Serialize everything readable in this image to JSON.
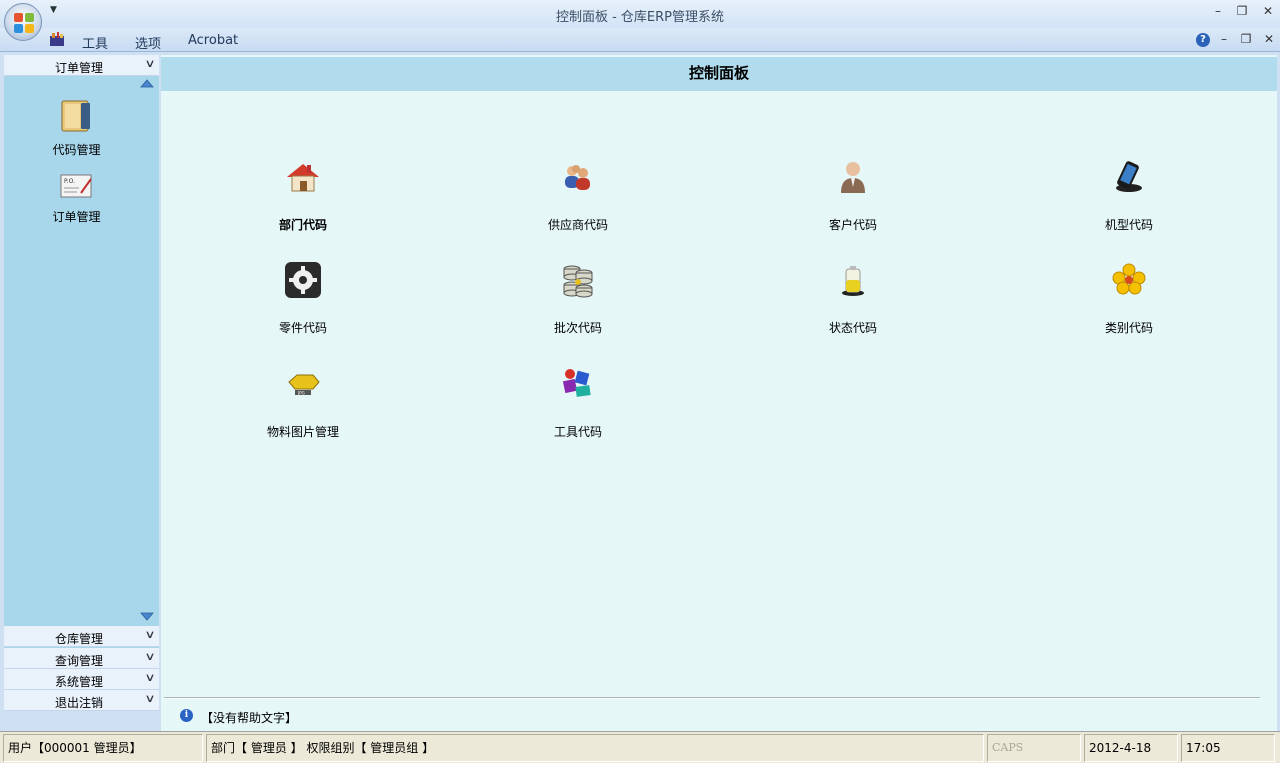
{
  "window": {
    "title": "控制面板 - 仓库ERP管理系统"
  },
  "menu": {
    "items": [
      "工具",
      "选项",
      "Acrobat"
    ]
  },
  "leftnav": {
    "active_header": "订单管理",
    "tiles": [
      {
        "label": "代码管理",
        "icon": "folder-icon"
      },
      {
        "label": "订单管理",
        "icon": "purchase-order-icon"
      }
    ],
    "bottom_headers": [
      "仓库管理",
      "查询管理",
      "系统管理",
      "退出注销"
    ]
  },
  "panel": {
    "title": "控制面板",
    "tiles": [
      {
        "label": "部门代码",
        "icon": "house-icon",
        "bold": true
      },
      {
        "label": "供应商代码",
        "icon": "users-icon"
      },
      {
        "label": "客户代码",
        "icon": "customer-icon"
      },
      {
        "label": "机型代码",
        "icon": "phone-icon"
      },
      {
        "label": "零件代码",
        "icon": "gear-icon"
      },
      {
        "label": "批次代码",
        "icon": "database-stack-icon"
      },
      {
        "label": "状态代码",
        "icon": "battery-icon"
      },
      {
        "label": "类别代码",
        "icon": "flower-icon"
      },
      {
        "label": "物料图片管理",
        "icon": "image-icon"
      },
      {
        "label": "工具代码",
        "icon": "blocks-icon"
      }
    ],
    "help_text": "【没有帮助文字】"
  },
  "status": {
    "user": "用户【000001 管理员】",
    "dept": "部门【 管理员 】 权限组别【 管理员组 】",
    "caps": "CAPS",
    "date": "2012-4-18",
    "time": "17:05"
  }
}
